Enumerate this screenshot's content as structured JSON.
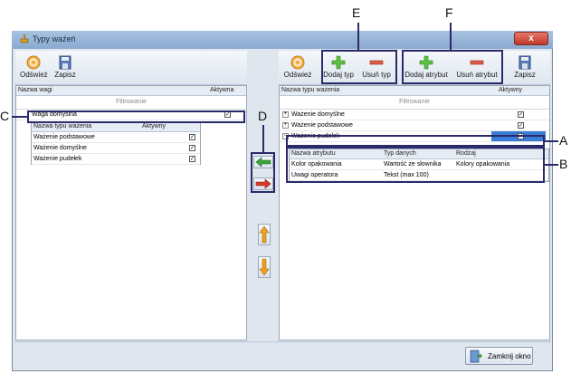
{
  "window": {
    "title": "Typy ważeń",
    "close_glyph": "x"
  },
  "callouts": {
    "A": "A",
    "B": "B",
    "C": "C",
    "D": "D",
    "E": "E",
    "F": "F"
  },
  "left_toolbar": {
    "refresh": "Odśwież",
    "save": "Zapisz"
  },
  "right_toolbar": {
    "refresh": "Odśwież",
    "add_type": "Dodaj typ",
    "remove_type": "Usuń typ",
    "add_attribute": "Dodaj atrybut",
    "remove_attribute": "Usuń atrybut",
    "save": "Zapisz"
  },
  "left_panel": {
    "col_name": "Nazwa wagi",
    "col_active": "Aktywna",
    "filter": "Filtrowanie",
    "selected_row": {
      "name": "Waga domyślna",
      "active": true
    },
    "subtable": {
      "col_name": "Nazwa typu ważenia",
      "col_active": "Aktywny",
      "rows": [
        {
          "name": "Ważenie podstawowe",
          "active": true
        },
        {
          "name": "Ważenie domyślne",
          "active": true
        },
        {
          "name": "Ważenie pudełek",
          "active": true
        }
      ]
    }
  },
  "right_panel": {
    "col_name": "Nazwa typu ważenia",
    "col_active": "Aktywny",
    "filter": "Filtrowanie",
    "rows": [
      {
        "name": "Ważenie domyślne",
        "active": true,
        "expander": "+"
      },
      {
        "name": "Ważenie podstawowe",
        "active": true,
        "expander": "+"
      },
      {
        "name": "Ważenie pudełek",
        "active": true,
        "expander": "−"
      }
    ],
    "attributes": {
      "col_name": "Nazwa atrybutu",
      "col_type": "Typ danych",
      "col_kind": "Rodzaj",
      "rows": [
        {
          "name": "Kolor opakowania",
          "type": "Wartość ze słownika",
          "kind": "Kolory opakowania"
        },
        {
          "name": "Uwagi operatora",
          "type": "Tekst (max 100)",
          "kind": ""
        }
      ]
    }
  },
  "footer": {
    "close_window": "Zamknij okno"
  },
  "colors": {
    "accent": "#2a2a6a",
    "selection": "#3a7bd5",
    "green": "#3aa63a",
    "red": "#d63a2a",
    "orange": "#f0a020"
  }
}
